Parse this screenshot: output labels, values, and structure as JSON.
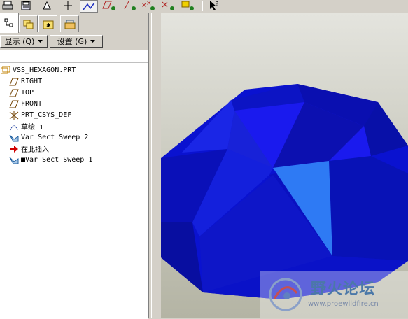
{
  "toolbar": {
    "icons": [
      "print-icon",
      "save-icon",
      "repaint-icon",
      "datum-axes-icon",
      "sketch-icon",
      "plane-display-icon",
      "point-display-icon",
      "csys-display-icon",
      "layer-display-icon",
      "help-cursor-icon"
    ]
  },
  "panel": {
    "tabs": [
      "model-tree-tab",
      "layer-tab",
      "folder-tab",
      "favorites-tab"
    ],
    "show_label": "显示 (Q)",
    "settings_label": "设置 (G)"
  },
  "tree": {
    "items": [
      {
        "label": "VSS_HEXAGON.PRT",
        "icon": "part-icon"
      },
      {
        "label": "RIGHT",
        "icon": "datum-plane-icon"
      },
      {
        "label": "TOP",
        "icon": "datum-plane-icon"
      },
      {
        "label": "FRONT",
        "icon": "datum-plane-icon"
      },
      {
        "label": "PRT_CSYS_DEF",
        "icon": "csys-icon"
      },
      {
        "label": "草绘 1",
        "icon": "sketch-icon"
      },
      {
        "label": "Var Sect Sweep 2",
        "icon": "sweep-icon"
      },
      {
        "label": "在此插入",
        "icon": "insert-here-icon"
      },
      {
        "label": "■Var Sect Sweep 1",
        "icon": "sweep-icon"
      }
    ]
  },
  "model": {
    "color": "#1a1ae6"
  },
  "watermark": {
    "title": "野火论坛",
    "url": "www.proewildfire.cn"
  }
}
